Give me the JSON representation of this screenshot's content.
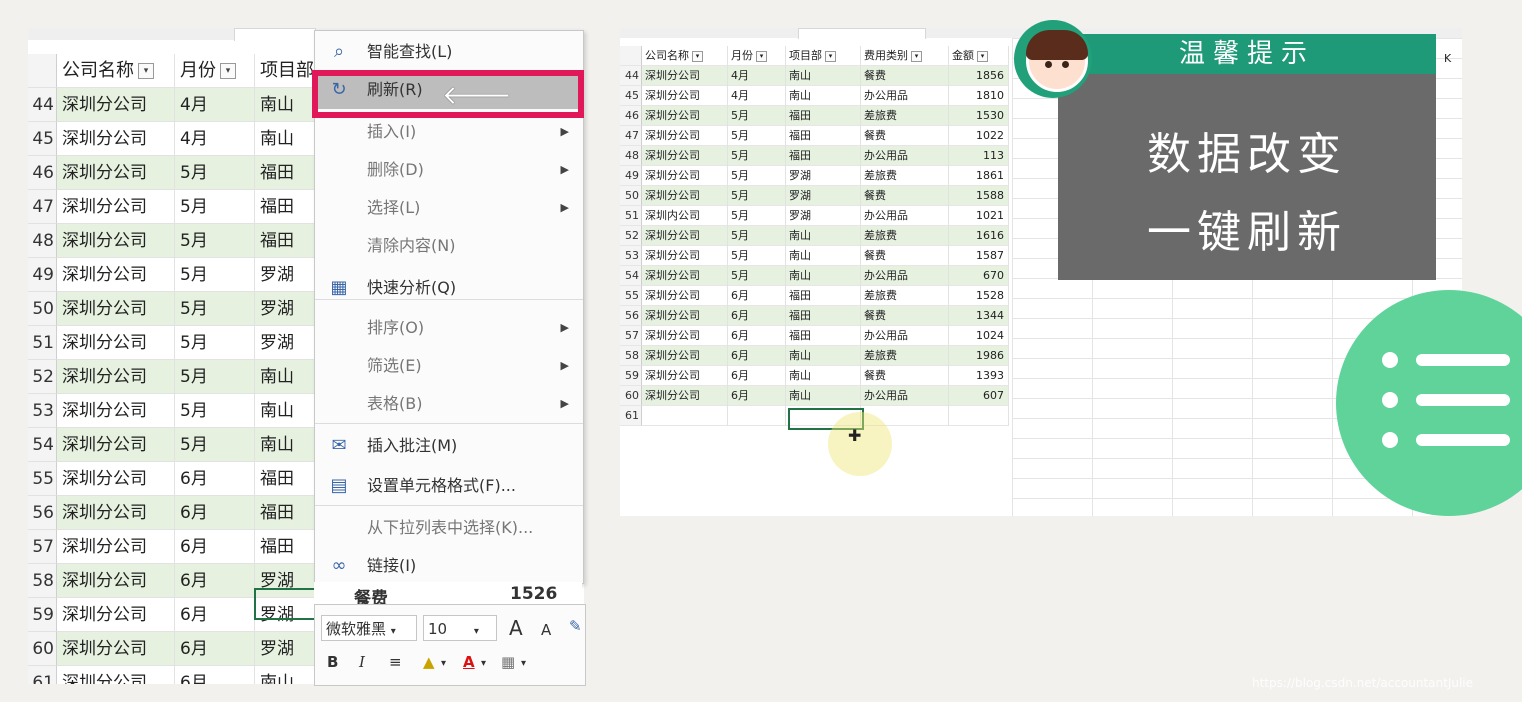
{
  "left_sheet": {
    "headers": [
      "公司名称",
      "月份",
      "项目部"
    ],
    "rows": [
      {
        "num": "44",
        "company": "深圳分公司",
        "month": "4月",
        "dept": "南山"
      },
      {
        "num": "45",
        "company": "深圳分公司",
        "month": "4月",
        "dept": "南山"
      },
      {
        "num": "46",
        "company": "深圳分公司",
        "month": "5月",
        "dept": "福田"
      },
      {
        "num": "47",
        "company": "深圳分公司",
        "month": "5月",
        "dept": "福田"
      },
      {
        "num": "48",
        "company": "深圳分公司",
        "month": "5月",
        "dept": "福田"
      },
      {
        "num": "49",
        "company": "深圳分公司",
        "month": "5月",
        "dept": "罗湖"
      },
      {
        "num": "50",
        "company": "深圳分公司",
        "month": "5月",
        "dept": "罗湖"
      },
      {
        "num": "51",
        "company": "深圳分公司",
        "month": "5月",
        "dept": "罗湖"
      },
      {
        "num": "52",
        "company": "深圳分公司",
        "month": "5月",
        "dept": "南山"
      },
      {
        "num": "53",
        "company": "深圳分公司",
        "month": "5月",
        "dept": "南山"
      },
      {
        "num": "54",
        "company": "深圳分公司",
        "month": "5月",
        "dept": "南山"
      },
      {
        "num": "55",
        "company": "深圳分公司",
        "month": "6月",
        "dept": "福田"
      },
      {
        "num": "56",
        "company": "深圳分公司",
        "month": "6月",
        "dept": "福田"
      },
      {
        "num": "57",
        "company": "深圳分公司",
        "month": "6月",
        "dept": "福田"
      },
      {
        "num": "58",
        "company": "深圳分公司",
        "month": "6月",
        "dept": "罗湖"
      },
      {
        "num": "59",
        "company": "深圳分公司",
        "month": "6月",
        "dept": "罗湖"
      },
      {
        "num": "60",
        "company": "深圳分公司",
        "month": "6月",
        "dept": "罗湖"
      },
      {
        "num": "61",
        "company": "深圳分公司",
        "month": "6月",
        "dept": "南山"
      }
    ],
    "peek_category": "餐费",
    "peek_amount": "1526"
  },
  "context_menu": {
    "items": [
      {
        "label": "智能查找(L)",
        "icon": "search-icon",
        "arrow": false,
        "highlighted": false
      },
      {
        "label": "刷新(R)",
        "icon": "refresh-icon",
        "arrow": false,
        "highlighted": true
      },
      {
        "label": "插入(I)",
        "icon": "",
        "arrow": true,
        "highlighted": false
      },
      {
        "label": "删除(D)",
        "icon": "",
        "arrow": true,
        "highlighted": false
      },
      {
        "label": "选择(L)",
        "icon": "",
        "arrow": true,
        "highlighted": false
      },
      {
        "label": "清除内容(N)",
        "icon": "",
        "arrow": false,
        "highlighted": false
      },
      {
        "label": "快速分析(Q)",
        "icon": "quick-analysis-icon",
        "arrow": false,
        "highlighted": false
      },
      {
        "label": "排序(O)",
        "icon": "",
        "arrow": true,
        "highlighted": false
      },
      {
        "label": "筛选(E)",
        "icon": "",
        "arrow": true,
        "highlighted": false
      },
      {
        "label": "表格(B)",
        "icon": "",
        "arrow": true,
        "highlighted": false
      },
      {
        "label": "插入批注(M)",
        "icon": "comment-icon",
        "arrow": false,
        "highlighted": false
      },
      {
        "label": "设置单元格格式(F)...",
        "icon": "format-cells-icon",
        "arrow": false,
        "highlighted": false
      },
      {
        "label": "从下拉列表中选择(K)...",
        "icon": "",
        "arrow": false,
        "highlighted": false
      },
      {
        "label": "链接(I)",
        "icon": "link-icon",
        "arrow": false,
        "highlighted": false
      }
    ]
  },
  "mini_toolbar": {
    "font_name": "微软雅黑",
    "font_size": "10",
    "bold": "B",
    "italic": "I",
    "grow_font": "A",
    "shrink_font": "A"
  },
  "right_sheet": {
    "headers": [
      "公司名称",
      "月份",
      "项目部",
      "费用类别",
      "金额"
    ],
    "column_k": "K",
    "rows": [
      {
        "num": "44",
        "company": "深圳分公司",
        "month": "4月",
        "dept": "南山",
        "category": "餐费",
        "amount": "1856"
      },
      {
        "num": "45",
        "company": "深圳分公司",
        "month": "4月",
        "dept": "南山",
        "category": "办公用品",
        "amount": "1810"
      },
      {
        "num": "46",
        "company": "深圳分公司",
        "month": "5月",
        "dept": "福田",
        "category": "差旅费",
        "amount": "1530"
      },
      {
        "num": "47",
        "company": "深圳分公司",
        "month": "5月",
        "dept": "福田",
        "category": "餐费",
        "amount": "1022"
      },
      {
        "num": "48",
        "company": "深圳分公司",
        "month": "5月",
        "dept": "福田",
        "category": "办公用品",
        "amount": "113"
      },
      {
        "num": "49",
        "company": "深圳分公司",
        "month": "5月",
        "dept": "罗湖",
        "category": "差旅费",
        "amount": "1861"
      },
      {
        "num": "50",
        "company": "深圳分公司",
        "month": "5月",
        "dept": "罗湖",
        "category": "餐费",
        "amount": "1588"
      },
      {
        "num": "51",
        "company": "深圳内公司",
        "month": "5月",
        "dept": "罗湖",
        "category": "办公用品",
        "amount": "1021"
      },
      {
        "num": "52",
        "company": "深圳分公司",
        "month": "5月",
        "dept": "南山",
        "category": "差旅费",
        "amount": "1616"
      },
      {
        "num": "53",
        "company": "深圳分公司",
        "month": "5月",
        "dept": "南山",
        "category": "餐费",
        "amount": "1587"
      },
      {
        "num": "54",
        "company": "深圳分公司",
        "month": "5月",
        "dept": "南山",
        "category": "办公用品",
        "amount": "670"
      },
      {
        "num": "55",
        "company": "深圳分公司",
        "month": "6月",
        "dept": "福田",
        "category": "差旅费",
        "amount": "1528"
      },
      {
        "num": "56",
        "company": "深圳分公司",
        "month": "6月",
        "dept": "福田",
        "category": "餐费",
        "amount": "1344"
      },
      {
        "num": "57",
        "company": "深圳分公司",
        "month": "6月",
        "dept": "福田",
        "category": "办公用品",
        "amount": "1024"
      },
      {
        "num": "58",
        "company": "深圳分公司",
        "month": "6月",
        "dept": "南山",
        "category": "差旅费",
        "amount": "1986"
      },
      {
        "num": "59",
        "company": "深圳分公司",
        "month": "6月",
        "dept": "南山",
        "category": "餐费",
        "amount": "1393"
      },
      {
        "num": "60",
        "company": "深圳分公司",
        "month": "6月",
        "dept": "南山",
        "category": "办公用品",
        "amount": "607"
      },
      {
        "num": "61",
        "company": "",
        "month": "",
        "dept": "",
        "category": "",
        "amount": ""
      }
    ]
  },
  "tip": {
    "title": "温馨提示",
    "line1": "数据改变",
    "line2": "一键刷新"
  },
  "watermark": "https://blog.csdn.net/accountantJulie",
  "colors": {
    "accent_red": "#e0185a",
    "tip_green": "#1f9a78",
    "tip_gray": "#6a6a6a",
    "badge_green": "#5fd39a",
    "row_band": "#e6f1e0",
    "excel_green": "#217346"
  }
}
